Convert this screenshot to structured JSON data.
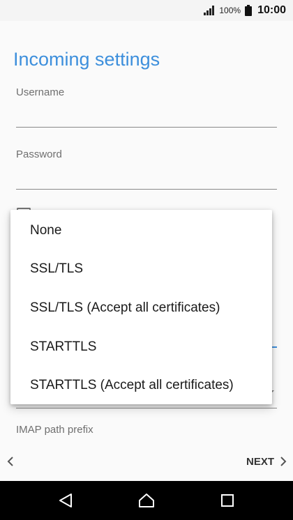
{
  "status_bar": {
    "battery_percent": "100%",
    "time": "10:00",
    "icons": [
      "signal-icon",
      "battery-icon"
    ]
  },
  "page": {
    "title": "Incoming settings"
  },
  "fields": {
    "username_label": "Username",
    "username_value": "",
    "password_label": "Password",
    "password_value": "",
    "imap_path_prefix_label": "IMAP path prefix"
  },
  "security_menu": {
    "options": [
      "None",
      "SSL/TLS",
      "SSL/TLS (Accept all certificates)",
      "STARTTLS",
      "STARTTLS (Accept all certificates)"
    ]
  },
  "bottom_nav": {
    "next_label": "NEXT"
  },
  "colors": {
    "accent": "#3d8fdc",
    "navbar": "#000000"
  }
}
